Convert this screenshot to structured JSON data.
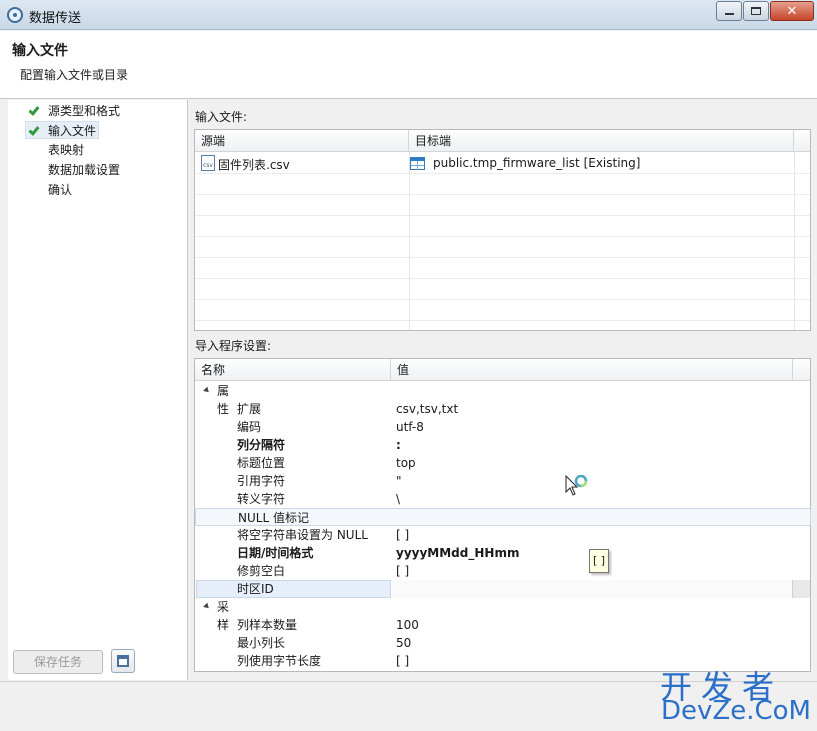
{
  "window": {
    "title": "数据传送",
    "close_glyph": "✕"
  },
  "header": {
    "title": "输入文件",
    "description": "配置输入文件或目录"
  },
  "nav": {
    "items": [
      {
        "label": "源类型和格式",
        "done": true
      },
      {
        "label": "输入文件",
        "done": true,
        "selected": true
      },
      {
        "label": "表映射",
        "done": false
      },
      {
        "label": "数据加载设置",
        "done": false
      },
      {
        "label": "确认",
        "done": false
      }
    ],
    "save_task_label": "保存任务"
  },
  "input_files": {
    "section_label": "输入文件:",
    "columns": [
      "源端",
      "目标端"
    ],
    "rows": [
      {
        "source": "固件列表.csv",
        "target": "public.tmp_firmware_list [Existing]"
      }
    ]
  },
  "importer_settings": {
    "section_label": "导入程序设置:",
    "columns": [
      "名称",
      "值"
    ],
    "groups": [
      {
        "label": "属性",
        "props": [
          {
            "name": "扩展",
            "value": "csv,tsv,txt",
            "bold": false
          },
          {
            "name": "编码",
            "value": "utf-8",
            "bold": false
          },
          {
            "name": "列分隔符",
            "value": ":",
            "bold": true
          },
          {
            "name": "标题位置",
            "value": "top",
            "bold": false
          },
          {
            "name": "引用字符",
            "value": "\"",
            "bold": false
          },
          {
            "name": "转义字符",
            "value": "\\",
            "bold": false
          },
          {
            "name": "NULL 值标记",
            "value": "",
            "bold": false
          },
          {
            "name": "将空字符串设置为 NULL",
            "value": "[ ]",
            "bold": false
          },
          {
            "name": "日期/时间格式",
            "value": "yyyyMMdd_HHmm",
            "bold": true
          },
          {
            "name": "修剪空白",
            "value": "[ ]",
            "bold": false
          },
          {
            "name": "时区ID",
            "value": "",
            "bold": false
          }
        ]
      },
      {
        "label": "采样",
        "props": [
          {
            "name": "列样本数量",
            "value": "100",
            "bold": false
          },
          {
            "name": "最小列长",
            "value": "50",
            "bold": false
          },
          {
            "name": "列使用字节长度",
            "value": "[ ]",
            "bold": false
          }
        ]
      }
    ]
  },
  "tooltip": {
    "text": "[ ]"
  },
  "watermark": {
    "top": "开发者",
    "bottom": "DevZe.CoM"
  }
}
